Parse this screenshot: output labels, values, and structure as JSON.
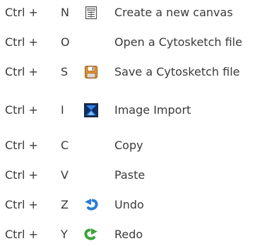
{
  "shortcuts": [
    {
      "modifier": "Ctrl +",
      "key": "N",
      "icon": "new-canvas-icon",
      "label": "Create a new canvas"
    },
    {
      "modifier": "Ctrl +",
      "key": "O",
      "icon": "",
      "label": "Open a Cytosketch file"
    },
    {
      "modifier": "Ctrl +",
      "key": "S",
      "icon": "save-icon",
      "label": "Save a Cytosketch file"
    },
    {
      "modifier": "Ctrl +",
      "key": "I",
      "icon": "image-import-icon",
      "label": "Image Import"
    },
    {
      "modifier": "Ctrl +",
      "key": "C",
      "icon": "",
      "label": "Copy"
    },
    {
      "modifier": "Ctrl +",
      "key": "V",
      "icon": "",
      "label": "Paste"
    },
    {
      "modifier": "Ctrl +",
      "key": "Z",
      "icon": "undo-icon",
      "label": "Undo"
    },
    {
      "modifier": "Ctrl +",
      "key": "Y",
      "icon": "redo-icon",
      "label": "Redo"
    }
  ],
  "colors": {
    "text": "#3a3a3a",
    "undo_blue": "#2a7fd4",
    "redo_green": "#3aa33a",
    "save_orange": "#e8912d",
    "image_blue": "#1b5fb0"
  }
}
